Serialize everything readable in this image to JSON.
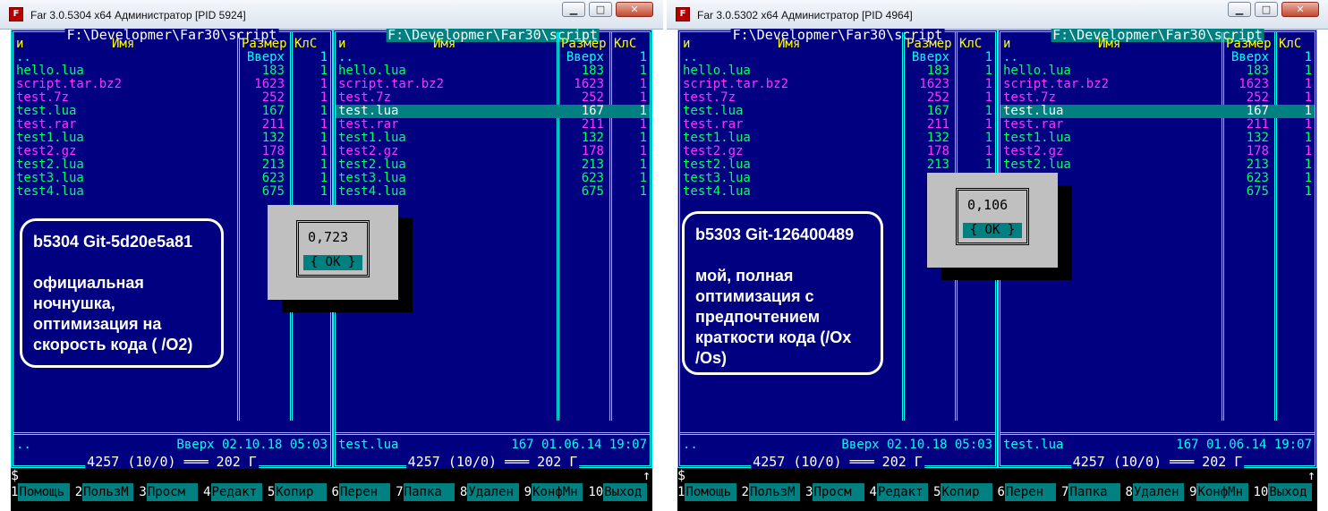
{
  "left_window": {
    "title": "Far 3.0.5304 x64 Администратор [PID 5924]",
    "controls": {
      "min": "▁",
      "max": "□",
      "close": "✕"
    },
    "left_panel": {
      "path": "F:\\Developmer\\Far30\\script",
      "headers": {
        "n": "и",
        "name": "Имя",
        "size": "Размер",
        "cls": "КлС"
      },
      "files": [
        {
          "name": "..",
          "size": "Вверх",
          "cls": "1",
          "color": "cyan"
        },
        {
          "name": "hello.lua",
          "size": "183",
          "cls": "1",
          "color": "green"
        },
        {
          "name": "script.tar.bz2",
          "size": "1623",
          "cls": "1",
          "color": "magenta"
        },
        {
          "name": "test.7z",
          "size": "252",
          "cls": "1",
          "color": "magenta"
        },
        {
          "name": "test.lua",
          "size": "167",
          "cls": "1",
          "color": "green"
        },
        {
          "name": "test.rar",
          "size": "211",
          "cls": "1",
          "color": "magenta"
        },
        {
          "name": "test1.lua",
          "size": "132",
          "cls": "1",
          "color": "green"
        },
        {
          "name": "test2.gz",
          "size": "178",
          "cls": "1",
          "color": "magenta"
        },
        {
          "name": "test2.lua",
          "size": "213",
          "cls": "1",
          "color": "green"
        },
        {
          "name": "test3.lua",
          "size": "623",
          "cls": "1",
          "color": "green"
        },
        {
          "name": "test4.lua",
          "size": "675",
          "cls": "1",
          "color": "green"
        }
      ],
      "status": {
        "name": "..",
        "info": "Вверх 02.10.18 05:03"
      },
      "totals": "4257 (10/0) ═══ 202 Г"
    },
    "right_panel": {
      "path": "F:\\Developmer\\Far30\\script",
      "headers": {
        "n": "и",
        "name": "Имя",
        "size": "Размер",
        "cls": "КлС"
      },
      "files": [
        {
          "name": "..",
          "size": "Вверх",
          "cls": "1",
          "color": "cyan"
        },
        {
          "name": "hello.lua",
          "size": "183",
          "cls": "1",
          "color": "green"
        },
        {
          "name": "script.tar.bz2",
          "size": "1623",
          "cls": "1",
          "color": "magenta"
        },
        {
          "name": "test.7z",
          "size": "252",
          "cls": "1",
          "color": "magenta"
        },
        {
          "name": "test.lua",
          "size": "167",
          "cls": "1",
          "color": "green",
          "selected": true
        },
        {
          "name": "test.rar",
          "size": "211",
          "cls": "1",
          "color": "magenta"
        },
        {
          "name": "test1.lua",
          "size": "132",
          "cls": "1",
          "color": "green"
        },
        {
          "name": "test2.gz",
          "size": "178",
          "cls": "1",
          "color": "magenta"
        },
        {
          "name": "test2.lua",
          "size": "213",
          "cls": "1",
          "color": "green"
        },
        {
          "name": "test3.lua",
          "size": "623",
          "cls": "1",
          "color": "green"
        },
        {
          "name": "test4.lua",
          "size": "675",
          "cls": "1",
          "color": "green"
        }
      ],
      "status": {
        "name": "test.lua",
        "info": "167 01.06.14 19:07"
      },
      "totals": "4257 (10/0) ═══ 202 Г"
    },
    "dialog": {
      "value": "0,723",
      "button": "{ OK }"
    },
    "note": {
      "line1": "b5304 Git-5d20e5a81",
      "body": [
        "официальная",
        "ночнушка,",
        "оптимизация на",
        "скорость кода ( /O2)"
      ]
    },
    "cmdline": {
      "prompt": "$",
      "arrow": "↑"
    },
    "keybar": [
      {
        "n": "1",
        "label": "Помощь"
      },
      {
        "n": "2",
        "label": "ПользМ"
      },
      {
        "n": "3",
        "label": "Просм"
      },
      {
        "n": "4",
        "label": "Редакт"
      },
      {
        "n": "5",
        "label": "Копир"
      },
      {
        "n": "6",
        "label": "Перен"
      },
      {
        "n": "7",
        "label": "Папка"
      },
      {
        "n": "8",
        "label": "Удален"
      },
      {
        "n": "9",
        "label": "КонфМн"
      },
      {
        "n": "10",
        "label": "Выход"
      }
    ]
  },
  "right_window": {
    "title": "Far 3.0.5302 x64 Администратор [PID 4964]",
    "controls": {
      "min": "▁",
      "max": "□",
      "close": "✕"
    },
    "left_panel": {
      "path": "F:\\Developmer\\Far30\\script",
      "headers": {
        "n": "и",
        "name": "Имя",
        "size": "Размер",
        "cls": "КлС"
      },
      "files": [
        {
          "name": "..",
          "size": "Вверх",
          "cls": "1",
          "color": "cyan"
        },
        {
          "name": "hello.lua",
          "size": "183",
          "cls": "1",
          "color": "green"
        },
        {
          "name": "script.tar.bz2",
          "size": "1623",
          "cls": "1",
          "color": "magenta"
        },
        {
          "name": "test.7z",
          "size": "252",
          "cls": "1",
          "color": "magenta"
        },
        {
          "name": "test.lua",
          "size": "167",
          "cls": "1",
          "color": "green"
        },
        {
          "name": "test.rar",
          "size": "211",
          "cls": "1",
          "color": "magenta"
        },
        {
          "name": "test1.lua",
          "size": "132",
          "cls": "1",
          "color": "green"
        },
        {
          "name": "test2.gz",
          "size": "178",
          "cls": "1",
          "color": "magenta"
        },
        {
          "name": "test2.lua",
          "size": "213",
          "cls": "1",
          "color": "green"
        },
        {
          "name": "test3.lua",
          "size": "",
          "cls": "",
          "color": "green"
        },
        {
          "name": "test4.lua",
          "size": "",
          "cls": "",
          "color": "green"
        }
      ],
      "status": {
        "name": "..",
        "info": "Вверх 02.10.18 05:03"
      },
      "totals": "4257 (10/0) ═══ 202 Г"
    },
    "right_panel": {
      "path": "F:\\Developmer\\Far30\\script",
      "headers": {
        "n": "и",
        "name": "Имя",
        "size": "Размер",
        "cls": "КлС"
      },
      "files": [
        {
          "name": "..",
          "size": "Вверх",
          "cls": "1",
          "color": "cyan"
        },
        {
          "name": "hello.lua",
          "size": "183",
          "cls": "1",
          "color": "green"
        },
        {
          "name": "script.tar.bz2",
          "size": "1623",
          "cls": "1",
          "color": "magenta"
        },
        {
          "name": "test.7z",
          "size": "252",
          "cls": "1",
          "color": "magenta"
        },
        {
          "name": "test.lua",
          "size": "167",
          "cls": "1",
          "color": "green",
          "selected": true
        },
        {
          "name": "test.rar",
          "size": "211",
          "cls": "1",
          "color": "magenta"
        },
        {
          "name": "test1.lua",
          "size": "132",
          "cls": "1",
          "color": "green"
        },
        {
          "name": "test2.gz",
          "size": "178",
          "cls": "1",
          "color": "magenta"
        },
        {
          "name": "test2.lua",
          "size": "213",
          "cls": "1",
          "color": "green"
        },
        {
          "name": "",
          "size": "623",
          "cls": "1",
          "color": "green"
        },
        {
          "name": "",
          "size": "675",
          "cls": "1",
          "color": "green"
        }
      ],
      "status": {
        "name": "test.lua",
        "info": "167 01.06.14 19:07"
      },
      "totals": "4257 (10/0) ═══ 202 Г"
    },
    "dialog": {
      "value": "0,106",
      "button": "{ OK }"
    },
    "note": {
      "line1": "b5303 Git-126400489",
      "body": [
        "мой, полная",
        "оптимизация с",
        "предпочтением",
        "краткости кода (/Ox",
        "/Os)"
      ]
    },
    "cmdline": {
      "prompt": "$",
      "arrow": "↑"
    },
    "keybar": [
      {
        "n": "1",
        "label": "Помощь"
      },
      {
        "n": "2",
        "label": "ПользМ"
      },
      {
        "n": "3",
        "label": "Просм"
      },
      {
        "n": "4",
        "label": "Редакт"
      },
      {
        "n": "5",
        "label": "Копир"
      },
      {
        "n": "6",
        "label": "Перен"
      },
      {
        "n": "7",
        "label": "Папка"
      },
      {
        "n": "8",
        "label": "Удален"
      },
      {
        "n": "9",
        "label": "КонфМн"
      },
      {
        "n": "10",
        "label": "Выход"
      }
    ]
  }
}
